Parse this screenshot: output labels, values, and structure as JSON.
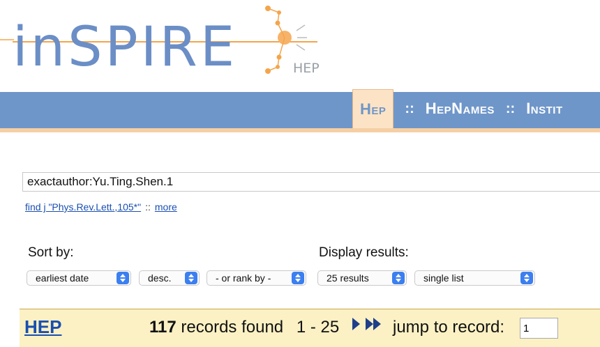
{
  "logo": {
    "wordmark": "inSPIRE",
    "sub_label": "HEP"
  },
  "nav": {
    "items": [
      {
        "label": "Hep",
        "active": true
      },
      {
        "label": "HepNames",
        "active": false
      },
      {
        "label": "Instit",
        "active": false
      }
    ],
    "separator": "::"
  },
  "search": {
    "query": "exactauthor:Yu.Ting.Shen.1",
    "example_link": "find j \"Phys.Rev.Lett.,105*\"",
    "separator": "::",
    "more_link": "more"
  },
  "sort": {
    "label": "Sort by:",
    "field": "earliest date",
    "order": "desc.",
    "rank": "- or rank by -"
  },
  "display": {
    "label": "Display results:",
    "per_page": "25 results",
    "format": "single list"
  },
  "results": {
    "collection": "HEP",
    "count": "117",
    "count_suffix": "records found",
    "range": "1 - 25",
    "jump_label": "jump to record:",
    "jump_value": "1"
  },
  "colors": {
    "nav_bar": "#6f96c9",
    "nav_active_tab": "#fce3c5",
    "results_bar": "#fcf1c4",
    "link": "#1a4fb0",
    "logo_orange": "#f4a54a"
  },
  "icons": {
    "next_page": "play-icon",
    "last_page": "fast-forward-icon",
    "select_arrows": "updown-chevron-icon"
  }
}
